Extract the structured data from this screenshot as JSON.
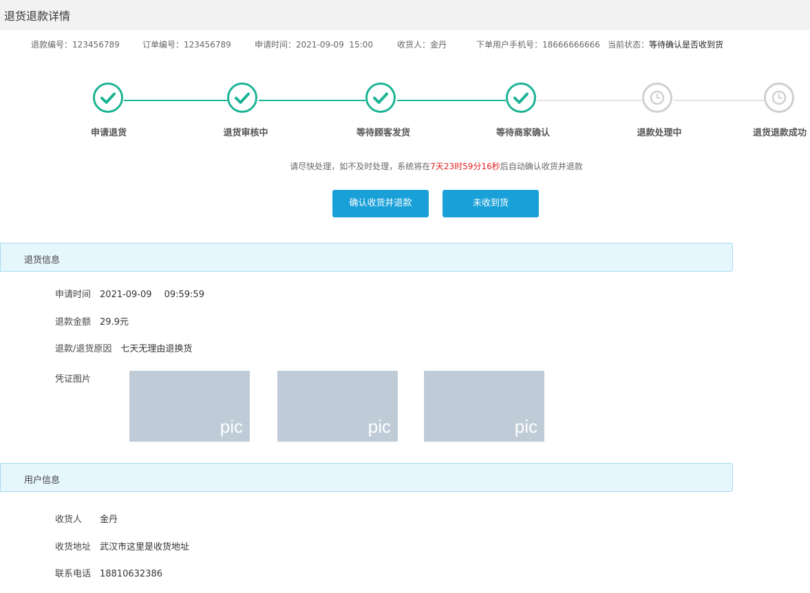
{
  "page_title": "退货退款详情",
  "meta": {
    "refund_no_label": "退款编号：",
    "refund_no": "123456789",
    "order_no_label": "订单编号：",
    "order_no": "123456789",
    "apply_time_label": "申请时间：",
    "apply_time": "2021-09-09  15:00",
    "receiver_label": "收货人：",
    "receiver": "金丹",
    "phone_label": "下单用户手机号：",
    "phone": "18666666666",
    "status_label": "当前状态：",
    "status": "等待确认是否收到货"
  },
  "steps": [
    {
      "label": "申请退货",
      "state": "done",
      "icon": "check-icon"
    },
    {
      "label": "退货审核中",
      "state": "done",
      "icon": "check-icon"
    },
    {
      "label": "等待顾客发货",
      "state": "done",
      "icon": "check-icon"
    },
    {
      "label": "等待商家确认",
      "state": "done",
      "icon": "check-icon"
    },
    {
      "label": "退款处理中",
      "state": "pending",
      "icon": "clock-icon"
    },
    {
      "label": "退货退款成功",
      "state": "pending",
      "icon": "clock-icon"
    }
  ],
  "notice": {
    "prefix": "请尽快处理，如不及时处理，系统将在",
    "countdown": "7天23时59分16秒",
    "suffix": "后自动确认收货并退款"
  },
  "buttons": {
    "confirm": "确认收货并退款",
    "not_received": "未收到货"
  },
  "return_info": {
    "section_title": "退货信息",
    "apply_time_label": "申请时间",
    "apply_date": "2021-09-09",
    "apply_clock": "09:59:59",
    "amount_label": "退款金额",
    "amount": "29.9元",
    "reason_label": "退款/退货原因",
    "reason": "七天无理由退换货",
    "proof_label": "凭证图片",
    "pics": [
      "pic",
      "pic",
      "pic"
    ]
  },
  "user_info": {
    "section_title": "用户信息",
    "receiver_label": "收货人",
    "receiver": "金丹",
    "address_label": "收货地址",
    "address": "武汉市这里是收货地址",
    "phone_label": "联系电话",
    "phone": "18810632386"
  },
  "colors": {
    "accent": "#1aa0d8",
    "success": "#1ab394",
    "pending": "#cfcfcf",
    "countdown": "#e02020"
  }
}
